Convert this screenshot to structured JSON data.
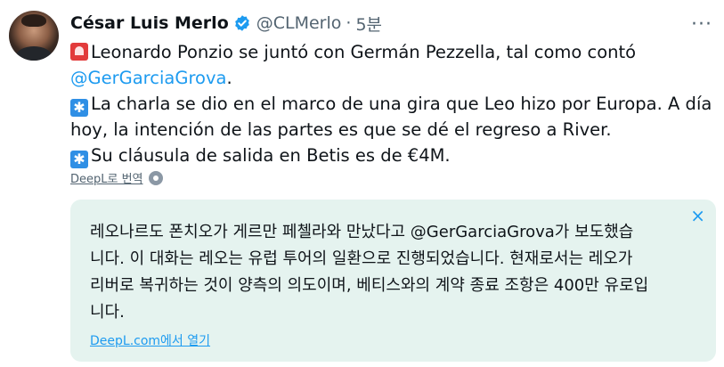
{
  "tweet": {
    "author_name": "César Luis Merlo",
    "handle": "@CLMerlo",
    "separator": "·",
    "time": "5분",
    "more_label": "···",
    "line1_pre": "Leonardo Ponzio se juntó con Germán Pezzella, tal como contó",
    "line2_mention": "@GerGarciaGrova",
    "line2_post": ".",
    "line3": "La charla se dio en el marco de una gira que Leo hizo por Europa. A día",
    "line4": "hoy, la intención de las partes es que se dé el regreso a River.",
    "line5": "Su cláusula de salida en Betis es de €4M.",
    "emoji_red": "rotating-light-icon",
    "emoji_blue": "sparkle-icon",
    "emoji_blue_glyph": "✱",
    "translate_link": "DeepL로 번역"
  },
  "translation": {
    "close_label": "×",
    "lines": [
      "레오나르도 폰치오가 게르만 페첼라와 만났다고 @GerGarciaGrova가 보도했습",
      "니다. 이 대화는 레오는 유럽 투어의 일환으로 진행되었습니다. 현재로서는 레오가",
      "리버로 복귀하는 것이 양측의 의도이며, 베티스와의 계약 종료 조항은 400만 유로입",
      "니다."
    ],
    "open_link": "DeepL.com에서 열기"
  },
  "colors": {
    "accent": "#1d9bf0",
    "translation_bg": "#e5f3ef",
    "muted": "#536471"
  }
}
